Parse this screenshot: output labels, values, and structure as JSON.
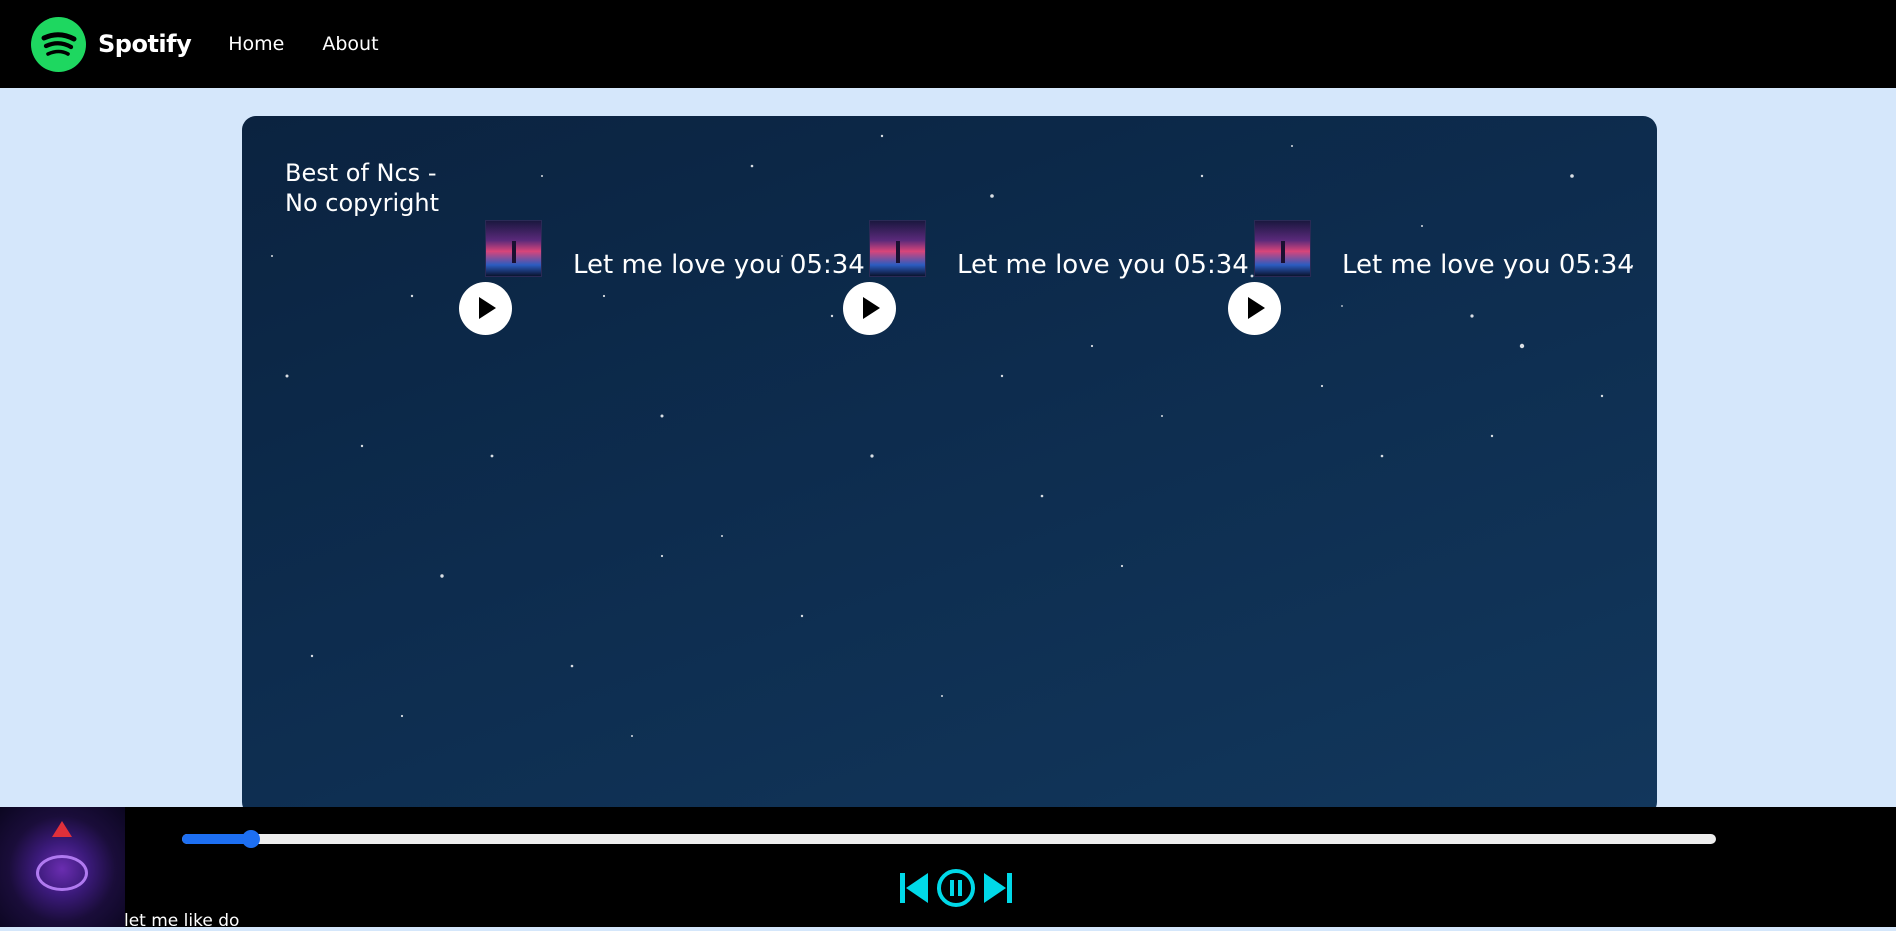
{
  "nav": {
    "brand": "Spotify",
    "links": [
      "Home",
      "About"
    ]
  },
  "playlist": {
    "title": "Best of Ncs - No copyright",
    "songs": [
      {
        "label": "Let me love you 05:34"
      },
      {
        "label": "Let me love you 05:34"
      },
      {
        "label": "Let me love you 05:34"
      }
    ]
  },
  "player": {
    "now_playing": "let me like do",
    "progress_fraction": 0.045,
    "accent_color": "#1d6ff2",
    "control_color": "#00d9e8",
    "controls": [
      "previous-icon",
      "pause-icon",
      "next-icon"
    ]
  },
  "colors": {
    "brand_green": "#1ed760",
    "page_bg": "#d5e7fb"
  }
}
